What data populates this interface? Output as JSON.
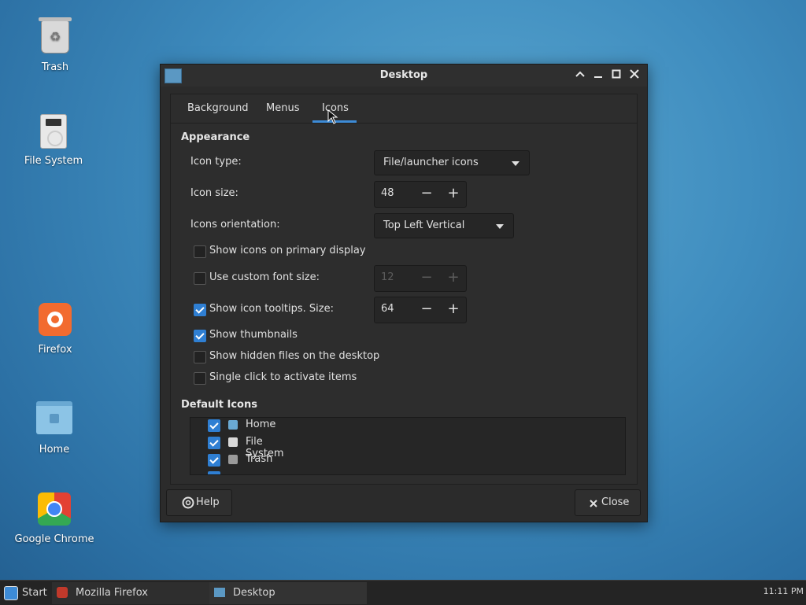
{
  "desktop": {
    "icons": [
      {
        "label": "Trash",
        "icon": "trash-icon"
      },
      {
        "label": "File System",
        "icon": "drive-icon"
      },
      {
        "label": "Firefox",
        "icon": "firefox-icon"
      },
      {
        "label": "Home",
        "icon": "folder-home-icon"
      },
      {
        "label": "Google Chrome",
        "icon": "chrome-icon"
      }
    ]
  },
  "window": {
    "title": "Desktop",
    "tabs": [
      {
        "label": "Background",
        "selected": false
      },
      {
        "label": "Menus",
        "selected": false
      },
      {
        "label": "Icons",
        "selected": true
      }
    ],
    "appearance": {
      "title": "Appearance",
      "icon_type": {
        "label": "Icon type:",
        "value": "File/launcher icons"
      },
      "icon_size": {
        "label": "Icon size:",
        "value": "48"
      },
      "orientation": {
        "label": "Icons orientation:",
        "value": "Top Left Vertical"
      },
      "show_primary": {
        "label": "Show icons on primary display",
        "checked": false
      },
      "custom_font": {
        "label": "Use custom font size:",
        "checked": false,
        "value": "12"
      },
      "tooltips": {
        "label": "Show icon tooltips. Size:",
        "checked": true,
        "value": "64"
      },
      "thumbnails": {
        "label": "Show thumbnails",
        "checked": true
      },
      "hidden_files": {
        "label": "Show hidden files on the desktop",
        "checked": false
      },
      "single_click": {
        "label": "Single click to activate items",
        "checked": false
      }
    },
    "default_icons": {
      "title": "Default Icons",
      "items": [
        {
          "label": "Home",
          "checked": true,
          "icon": "folder-home-icon"
        },
        {
          "label": "File System",
          "checked": true,
          "icon": "drive-icon"
        },
        {
          "label": "Trash",
          "checked": true,
          "icon": "trash-icon"
        }
      ]
    },
    "buttons": {
      "help": "Help",
      "close": "Close"
    }
  },
  "taskbar": {
    "start": "Start",
    "tasks": [
      {
        "label": "Mozilla Firefox",
        "active": false
      },
      {
        "label": "Desktop",
        "active": true
      }
    ],
    "clock": "11:11 PM"
  },
  "colors": {
    "accent": "#3d8bd6",
    "checkbox": "#2f7fd3",
    "window_bg": "#2b2b2b",
    "desktop": "#3f8dbf"
  }
}
